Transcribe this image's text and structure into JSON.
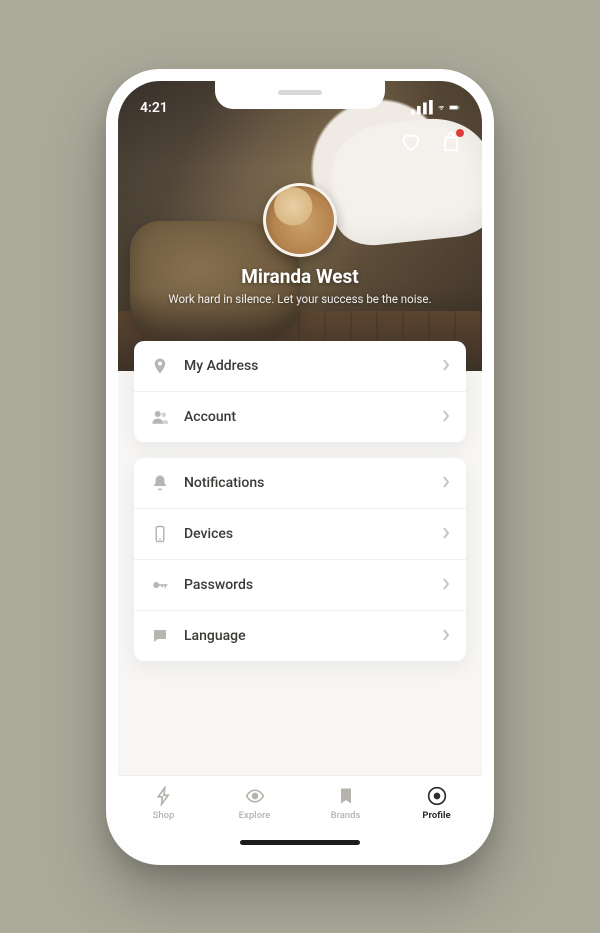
{
  "status_bar": {
    "time": "4:21"
  },
  "profile": {
    "name": "Miranda West",
    "bio": "Work hard in silence. Let your success be the noise."
  },
  "groups": [
    {
      "rows": [
        {
          "icon": "location-pin-icon",
          "label": "My Address"
        },
        {
          "icon": "people-icon",
          "label": "Account"
        }
      ]
    },
    {
      "rows": [
        {
          "icon": "bell-icon",
          "label": "Notifications"
        },
        {
          "icon": "device-icon",
          "label": "Devices"
        },
        {
          "icon": "key-icon",
          "label": "Passwords"
        },
        {
          "icon": "chat-icon",
          "label": "Language"
        }
      ]
    }
  ],
  "tabs": [
    {
      "icon": "bolt-icon",
      "label": "Shop",
      "active": false
    },
    {
      "icon": "eye-icon",
      "label": "Explore",
      "active": false
    },
    {
      "icon": "bookmark-icon",
      "label": "Brands",
      "active": false
    },
    {
      "icon": "profile-icon",
      "label": "Profile",
      "active": true
    }
  ]
}
